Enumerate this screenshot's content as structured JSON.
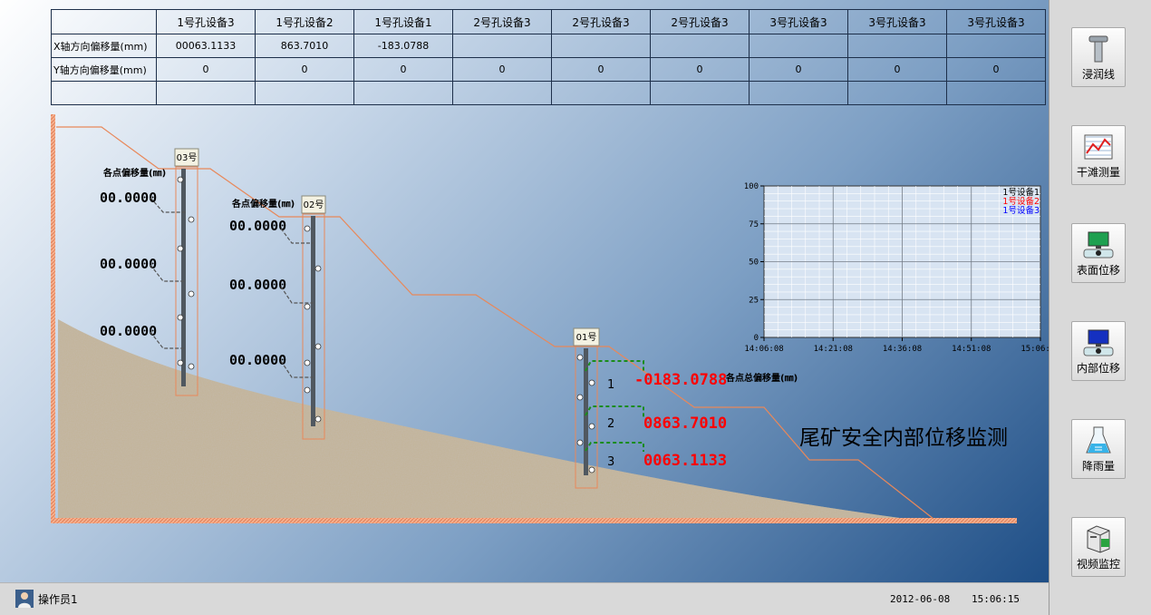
{
  "table": {
    "columns": [
      "1号孔设备3",
      "1号孔设备2",
      "1号孔设备1",
      "2号孔设备3",
      "2号孔设备3",
      "2号孔设备3",
      "3号孔设备3",
      "3号孔设备3",
      "3号孔设备3"
    ],
    "rows": [
      {
        "label": "X轴方向偏移量(mm)",
        "values": [
          "00063.1133",
          "863.7010",
          "-183.0788",
          "",
          "",
          "",
          "",
          "",
          ""
        ]
      },
      {
        "label": "Y轴方向偏移量(mm)",
        "values": [
          "0",
          "0",
          "0",
          "0",
          "0",
          "0",
          "0",
          "0",
          "0"
        ]
      },
      {
        "label": "",
        "values": [
          "",
          "",
          "",
          "",
          "",
          "",
          "",
          "",
          ""
        ]
      }
    ]
  },
  "scene": {
    "title": "尾矿安全内部位移监测",
    "well03": {
      "tag": "03号",
      "caption": "各点偏移量(㎜)",
      "readings": [
        "00.0000",
        "00.0000",
        "00.0000"
      ]
    },
    "well02": {
      "tag": "02号",
      "caption": "各点偏移量(㎜)",
      "readings": [
        "00.0000",
        "00.0000",
        "00.0000"
      ]
    },
    "well01": {
      "tag": "01号",
      "caption": "各点总偏移量(㎜)",
      "points": [
        {
          "index": "1",
          "reading": "-0183.0788"
        },
        {
          "index": "2",
          "reading": "0863.7010"
        },
        {
          "index": "3",
          "reading": "0063.1133"
        }
      ]
    }
  },
  "chart_data": {
    "type": "line",
    "x_ticks": [
      "14:06:08",
      "14:21:08",
      "14:36:08",
      "14:51:08",
      "15:06:08"
    ],
    "y_ticks": [
      "0",
      "25",
      "50",
      "75",
      "100"
    ],
    "ylim": [
      0,
      100
    ],
    "grid": true,
    "legend_position": "top-right",
    "series": [
      {
        "name": "1号设备1",
        "color": "#000000",
        "values": []
      },
      {
        "name": "1号设备2",
        "color": "#ff0000",
        "values": []
      },
      {
        "name": "1号设备3",
        "color": "#0000ff",
        "values": []
      }
    ]
  },
  "sidebar": {
    "items": [
      {
        "label": "浸润线",
        "icon": "pipe-icon"
      },
      {
        "label": "干滩测量",
        "icon": "chart-icon"
      },
      {
        "label": "表面位移",
        "icon": "monitor-icon"
      },
      {
        "label": "内部位移",
        "icon": "monitor-blue-icon"
      },
      {
        "label": "降雨量",
        "icon": "flask-icon"
      },
      {
        "label": "视频监控",
        "icon": "video-server-icon"
      }
    ]
  },
  "status": {
    "operator": "操作员1",
    "date": "2012-06-08",
    "time": "15:06:15"
  },
  "colors": {
    "reading_red": "#ff0000",
    "dam_line": "#e8885a",
    "leader_green": "#1a8c1a"
  }
}
